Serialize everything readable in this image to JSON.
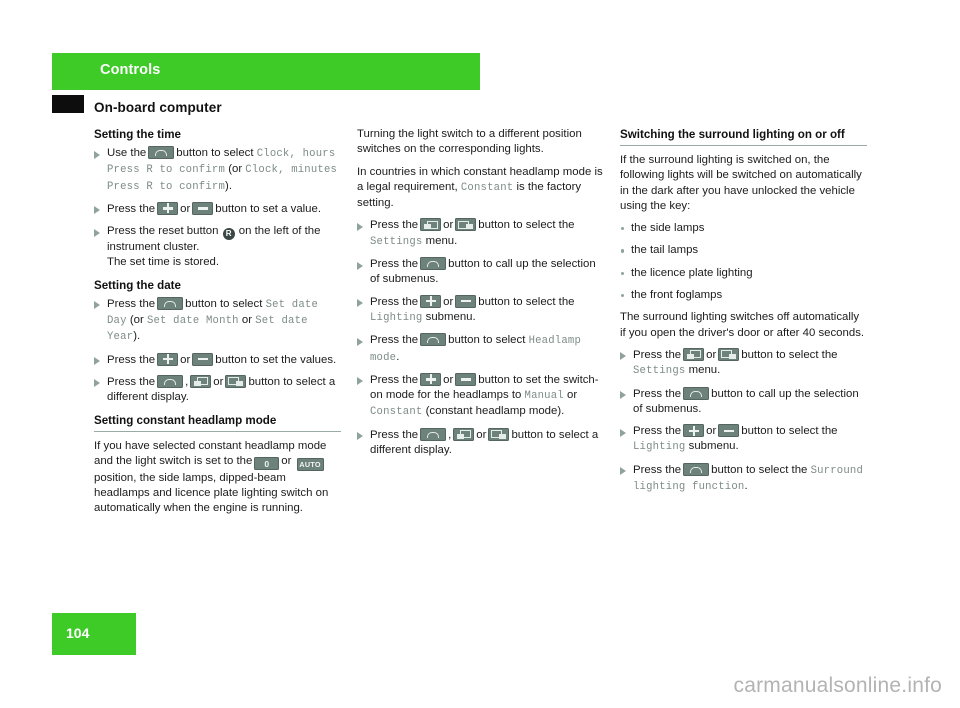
{
  "header": {
    "chapter_label": "Controls",
    "section_title": "On-board computer",
    "green": "#3ecb27"
  },
  "page": {
    "number": "104",
    "watermark": "carmanualsonline.info"
  },
  "columns": {
    "col1": {
      "heading_time": "Setting the time",
      "time_step1_a": "Use the",
      "time_step1_b": "button to select",
      "time_step1_mono1": "Clock, hours Press R to confirm",
      "time_step1_c": "(or",
      "time_step1_mono2": "Clock, minutes Press R to confirm",
      "time_step1_d": ").",
      "time_step2_a": "Press the",
      "time_step2_or": "or",
      "time_step2_b": "button to set a value.",
      "time_step3_a": "Press the reset button",
      "time_step3_b": "on the left of the instrument cluster.",
      "time_step3_note": "The set time is stored.",
      "heading_date": "Setting the date",
      "date_step1_a": "Press the",
      "date_step1_b": "button to select",
      "date_step1_mono1": "Set date Day",
      "date_step1_c": "(or",
      "date_step1_mono2": "Set date Month",
      "date_step1_d": "or",
      "date_step1_mono3": "Set date Year",
      "date_step1_e": ").",
      "date_step2_a": "Press the",
      "date_step2_or": "or",
      "date_step2_b": "button to set the values.",
      "date_step3_a": "Press the",
      "date_step3_comma": ",",
      "date_step3_or": "or",
      "date_step3_b": "button to select a different display.",
      "heading_headlamp": "Setting constant headlamp mode",
      "headlamp_para_a": "If you have selected constant headlamp mode and the light switch is set to the",
      "headlamp_or": "or",
      "headlamp_para_b": "position, the side lamps, dipped-beam headlamps and licence plate lighting switch on automatically when the engine is running.",
      "lamp_zero_label": "0",
      "lamp_auto_label": "AUTO"
    },
    "col2": {
      "para1": "Turning the light switch to a different position switches on the corresponding lights.",
      "para2_a": "In countries in which constant headlamp mode is a legal requirement,",
      "para2_mono": "Constant",
      "para2_b": "is the factory setting.",
      "step1_a": "Press the",
      "step1_or": "or",
      "step1_b": "button to select the",
      "step1_mono": "Settings",
      "step1_c": "menu.",
      "step2_a": "Press the",
      "step2_b": "button to call up the selection of submenus.",
      "step3_a": "Press the",
      "step3_or": "or",
      "step3_b": "button to select the",
      "step3_mono": "Lighting",
      "step3_c": "submenu.",
      "step4_a": "Press the",
      "step4_b": "button to select",
      "step4_mono": "Headlamp mode",
      "step4_c": ".",
      "step5_a": "Press the",
      "step5_or": "or",
      "step5_b": "button to set the switch-on mode for the headlamps to",
      "step5_mono1": "Manual",
      "step5_c": "or",
      "step5_mono2": "Constant",
      "step5_d": "(constant headlamp mode).",
      "step6_a": "Press the",
      "step6_comma": ",",
      "step6_or": "or",
      "step6_b": "button to select a different display."
    },
    "col3": {
      "heading": "Switching the surround lighting on or off",
      "para1": "If the surround lighting is switched on, the following lights will be switched on automatically in the dark after you have unlocked the vehicle using the key:",
      "bullets": [
        "the side lamps",
        "the tail lamps",
        "the licence plate lighting",
        "the front foglamps"
      ],
      "para2": "The surround lighting switches off automatically if you open the driver's door or after 40 seconds.",
      "step1_a": "Press the",
      "step1_or": "or",
      "step1_b": "button to select the",
      "step1_mono": "Settings",
      "step1_c": "menu.",
      "step2_a": "Press the",
      "step2_b": "button to call up the selection of submenus.",
      "step3_a": "Press the",
      "step3_or": "or",
      "step3_b": "button to select the",
      "step3_mono": "Lighting",
      "step3_c": "submenu.",
      "step4_a": "Press the",
      "step4_b": "button to select the",
      "step4_mono": "Surround lighting function",
      "step4_c": "."
    }
  }
}
